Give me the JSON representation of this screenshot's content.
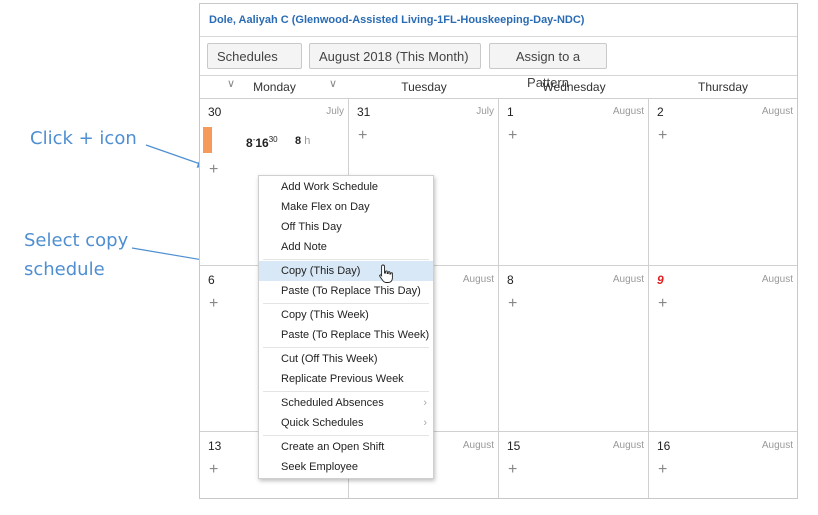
{
  "annotations": {
    "click_icon": "Click + icon",
    "select_copy_line1": "Select copy",
    "select_copy_line2": "schedule"
  },
  "header": {
    "title": "Dole, Aaliyah C (Glenwood-Assisted Living-1FL-Houskeeping-Day-NDC)"
  },
  "toolbar": {
    "schedules_label": "Schedules",
    "month_label": "August 2018 (This Month)",
    "assign_label": "Assign to a Pattern"
  },
  "calendar": {
    "days": [
      "Monday",
      "Tuesday",
      "Wednesday",
      "Thursday"
    ],
    "weeks": [
      [
        {
          "day": "30",
          "month": "July"
        },
        {
          "day": "31",
          "month": "July"
        },
        {
          "day": "1",
          "month": "August"
        },
        {
          "day": "2",
          "month": "August"
        }
      ],
      [
        {
          "day": "6",
          "month": ""
        },
        {
          "day": "",
          "month": "August"
        },
        {
          "day": "8",
          "month": "August"
        },
        {
          "day": "9",
          "month": "August"
        }
      ],
      [
        {
          "day": "13",
          "month": ""
        },
        {
          "day": "",
          "month": "August"
        },
        {
          "day": "15",
          "month": "August"
        },
        {
          "day": "16",
          "month": "August"
        }
      ]
    ],
    "plus_glyph": "+",
    "shift": {
      "start": "8",
      "end": "16",
      "end_minutes": "30",
      "hours": "8",
      "hours_unit": "h"
    }
  },
  "context_menu": {
    "items": [
      "Add Work Schedule",
      "Make Flex on Day",
      "Off This Day",
      "Add Note",
      "Copy (This Day)",
      "Paste (To Replace This Day)",
      "Copy (This Week)",
      "Paste (To Replace This Week)",
      "Cut (Off This Week)",
      "Replicate Previous Week",
      "Scheduled Absences",
      "Quick Schedules",
      "Create an Open Shift",
      "Seek Employee"
    ],
    "highlighted": "Copy (This Day)"
  },
  "colors": {
    "accent": "#2a6cb4",
    "annotation": "#4f8fd1",
    "shift": "#f59a5c",
    "holiday": "#e02020",
    "highlight": "#d9e8f7"
  }
}
